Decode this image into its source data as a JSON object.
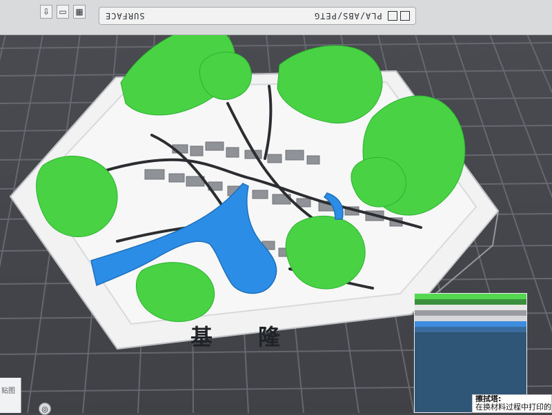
{
  "toolbar": {
    "plate_text": "PLA/ABS/PETG",
    "plate_sub_text": "SURFACE"
  },
  "model": {
    "label_chars": [
      "基",
      "隆"
    ]
  },
  "tooltip": {
    "title": "擦拭塔:",
    "line1": "在换材料过程中打印的立方体",
    "line2": "..."
  },
  "bottom_left": {
    "text": "贴图"
  },
  "colors": {
    "background": "#43454b",
    "bed_grid": "#6a6c73",
    "grass": "#49d344",
    "water": "#2b8de6",
    "base": "#f2f2f2"
  }
}
